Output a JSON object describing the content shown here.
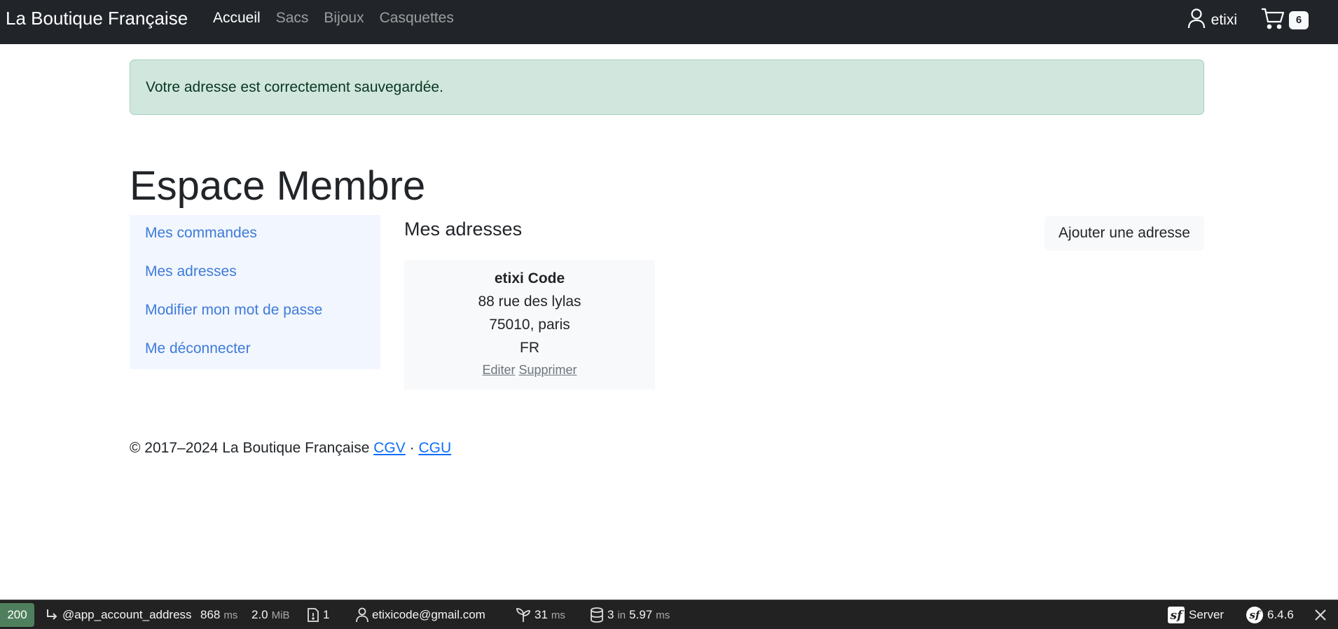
{
  "navbar": {
    "brand": "La Boutique Française",
    "links": [
      {
        "label": "Accueil",
        "active": true
      },
      {
        "label": "Sacs",
        "active": false
      },
      {
        "label": "Bijoux",
        "active": false
      },
      {
        "label": "Casquettes",
        "active": false
      }
    ],
    "user": {
      "name": "etixi",
      "icon": "user-icon"
    },
    "cart": {
      "count": "6",
      "icon": "cart-icon"
    }
  },
  "alert": {
    "message": "Votre adresse est correctement sauvegardée."
  },
  "page": {
    "title": "Espace Membre"
  },
  "sidebar": {
    "items": [
      {
        "label": "Mes commandes"
      },
      {
        "label": "Mes adresses"
      },
      {
        "label": "Modifier mon mot de passe"
      },
      {
        "label": "Me déconnecter"
      }
    ]
  },
  "addresses": {
    "title": "Mes adresses",
    "add_button": "Ajouter une adresse",
    "card": {
      "name": "etixi Code",
      "street": "88 rue des lylas",
      "city": "75010, paris",
      "country": "FR",
      "edit_label": "Editer",
      "delete_label": "Supprimer"
    }
  },
  "footer": {
    "copyright": "© 2017–2024 La Boutique Française",
    "cgv": "CGV",
    "separator": "·",
    "cgu": "CGU"
  },
  "debug_toolbar": {
    "status": "200",
    "route": "@app_account_address",
    "time_value": "868",
    "time_unit": "ms",
    "memory_value": "2.0",
    "memory_unit": "MiB",
    "forms_count": "1",
    "user_email": "etixicode@gmail.com",
    "twig_value": "31",
    "twig_unit": "ms",
    "db_queries": "3",
    "db_in": "in",
    "db_time": "5.97",
    "db_unit": "ms",
    "server_label": "Server",
    "symfony_version": "6.4.6",
    "colors": {
      "status_ok": "#4f805d"
    }
  },
  "colors": {
    "navbar_bg": "#212529",
    "alert_bg": "#d1e7dd",
    "link": "#3d7bd8",
    "sidebar_bg": "#f2f6ff"
  }
}
